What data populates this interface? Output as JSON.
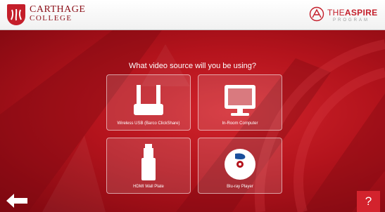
{
  "header": {
    "brand_line1": "CARTHAGE",
    "brand_line2": "COLLEGE",
    "program_prefix": "THE",
    "program_name": "ASPIRE",
    "program_sub": "PROGRAM"
  },
  "main": {
    "question": "What video source will you be using?",
    "sources": [
      {
        "label": "Wireless USB (Barco ClickShare)",
        "icon": "wireless-router-icon"
      },
      {
        "label": "In-Room Computer",
        "icon": "monitor-icon"
      },
      {
        "label": "HDMI Wall Plate",
        "icon": "hdmi-plug-icon"
      },
      {
        "label": "Blu-ray Player",
        "icon": "bluray-disc-icon"
      }
    ]
  },
  "footer": {
    "back_icon": "back-arrow-icon",
    "help_label": "?"
  },
  "colors": {
    "accent": "#c41e2a",
    "background": "#b3131c"
  }
}
